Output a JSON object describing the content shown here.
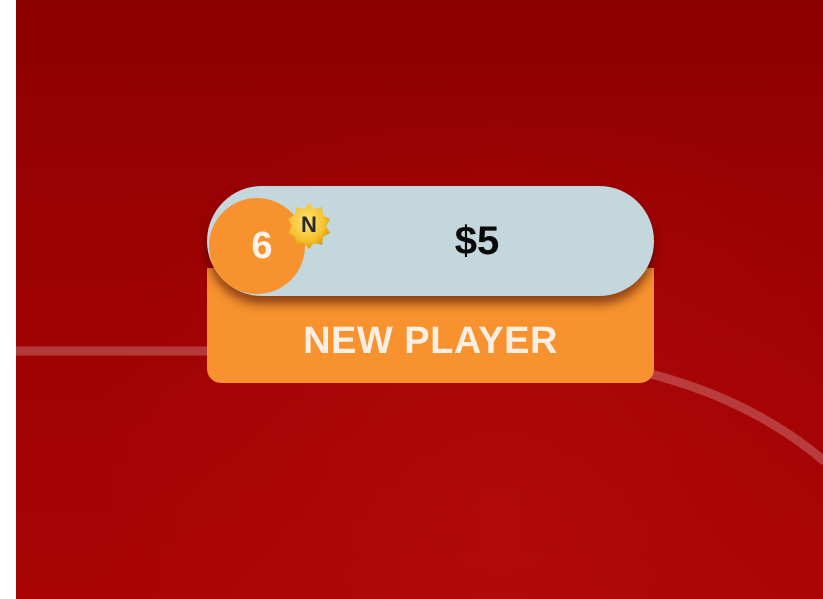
{
  "player_seat": {
    "seat_number": "6",
    "new_badge": "N",
    "stack": "$5",
    "status": "NEW PLAYER"
  },
  "colors": {
    "felt": "#9c0202",
    "plate": "#f7922e",
    "pill": "#c3d7dc",
    "badge": "#f5c12e"
  }
}
